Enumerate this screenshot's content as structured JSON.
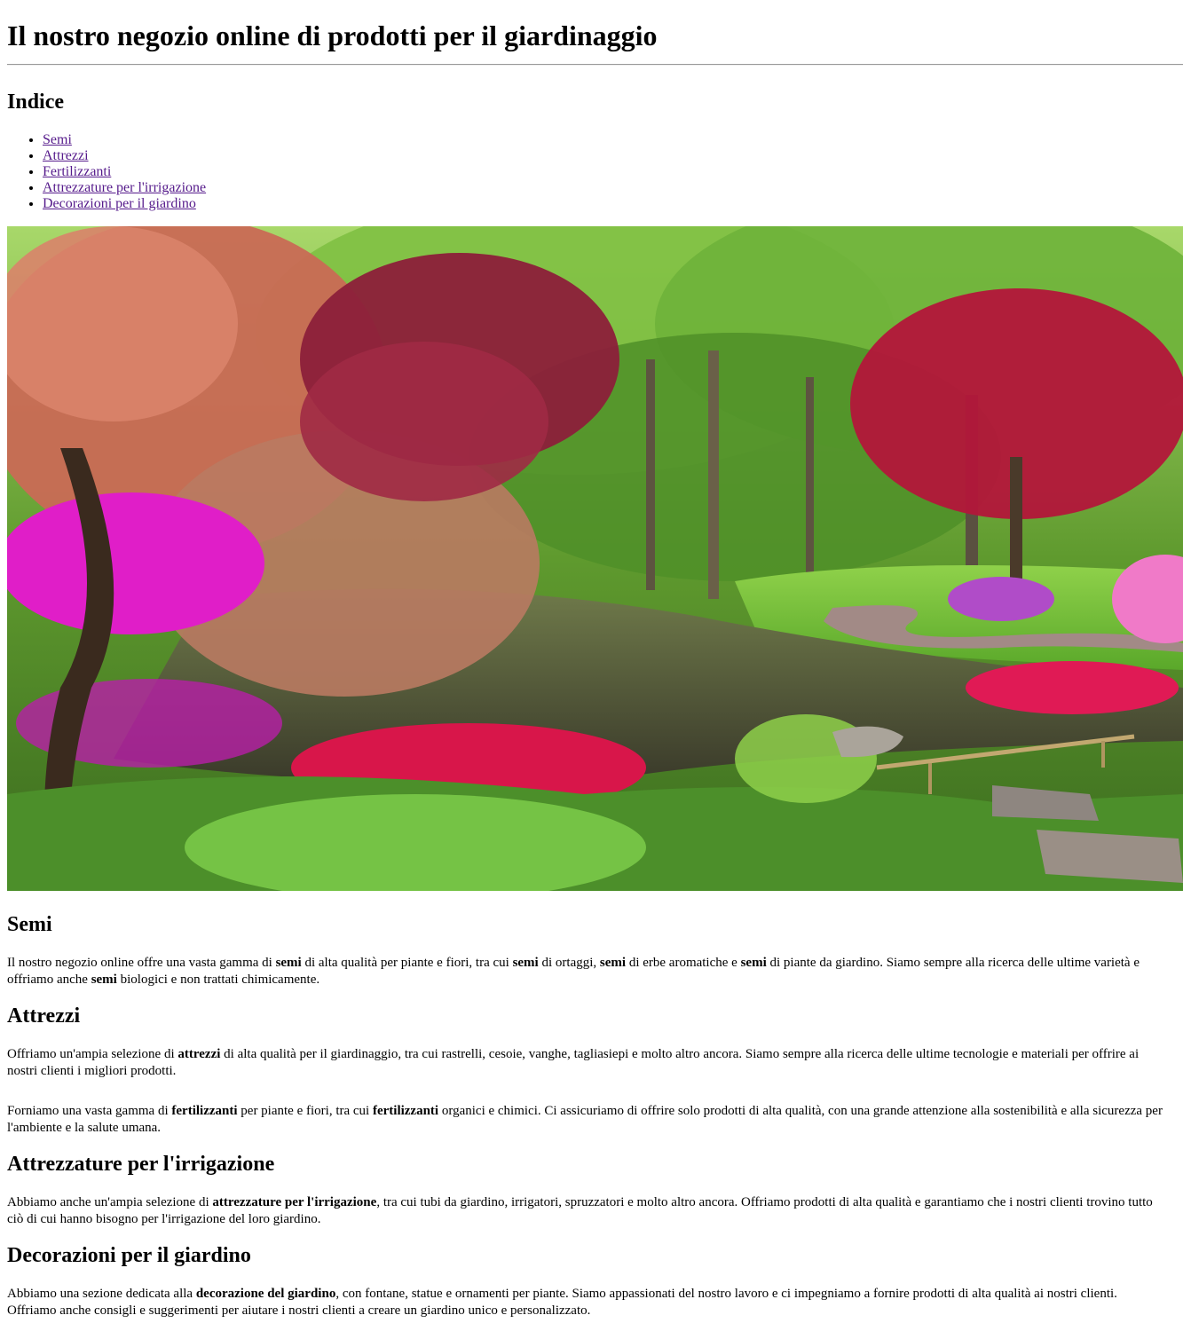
{
  "header": {
    "title": "Il nostro negozio online di prodotti per il giardinaggio"
  },
  "toc": {
    "title": "Indice",
    "items": [
      {
        "label": "Semi"
      },
      {
        "label": "Attrezzi"
      },
      {
        "label": "Fertilizzanti"
      },
      {
        "label": "Attrezzature per l'irrigazione"
      },
      {
        "label": "Decorazioni per il giardino"
      }
    ]
  },
  "hero": {
    "icon": "garden-photo"
  },
  "sections": [
    {
      "title": "Semi",
      "parts": [
        {
          "t": "Il nostro negozio online offre una vasta gamma di "
        },
        {
          "b": "semi"
        },
        {
          "t": " di alta qualità per piante e fiori, tra cui "
        },
        {
          "b": "semi"
        },
        {
          "t": " di ortaggi, "
        },
        {
          "b": "semi"
        },
        {
          "t": " di erbe aromatiche e "
        },
        {
          "b": "semi"
        },
        {
          "t": " di piante da giardino. Siamo sempre alla ricerca delle ultime varietà e offriamo anche "
        },
        {
          "b": "semi"
        },
        {
          "t": " biologici e non trattati chimicamente."
        }
      ]
    },
    {
      "title": "Attrezzi",
      "parts": [
        {
          "t": "Offriamo un'ampia selezione di "
        },
        {
          "b": "attrezzi"
        },
        {
          "t": " di alta qualità per il giardinaggio, tra cui rastrelli, cesoie, vanghe, tagliasiepi e molto altro ancora. Siamo sempre alla ricerca delle ultime tecnologie e materiali per offrire ai nostri clienti i migliori prodotti."
        }
      ]
    },
    {
      "title": "",
      "parts": [
        {
          "t": "Forniamo una vasta gamma di "
        },
        {
          "b": "fertilizzanti"
        },
        {
          "t": " per piante e fiori, tra cui "
        },
        {
          "b": "fertilizzanti"
        },
        {
          "t": " organici e chimici. Ci assicuriamo di offrire solo prodotti di alta qualità, con una grande attenzione alla sostenibilità e alla sicurezza per l'ambiente e la salute umana."
        }
      ]
    },
    {
      "title": "Attrezzature per l'irrigazione",
      "parts": [
        {
          "t": "Abbiamo anche un'ampia selezione di "
        },
        {
          "b": "attrezzature per l'irrigazione"
        },
        {
          "t": ", tra cui tubi da giardino, irrigatori, spruzzatori e molto altro ancora. Offriamo prodotti di alta qualità e garantiamo che i nostri clienti trovino tutto ciò di cui hanno bisogno per l'irrigazione del loro giardino."
        }
      ]
    },
    {
      "title": "Decorazioni per il giardino",
      "parts": [
        {
          "t": "Abbiamo una sezione dedicata alla "
        },
        {
          "b": "decorazione del giardino"
        },
        {
          "t": ", con fontane, statue e ornamenti per piante. Siamo appassionati del nostro lavoro e ci impegniamo a fornire prodotti di alta qualità ai nostri clienti. Offriamo anche consigli e suggerimenti per aiutare i nostri clienti a creare un giardino unico e personalizzato."
        }
      ]
    }
  ]
}
